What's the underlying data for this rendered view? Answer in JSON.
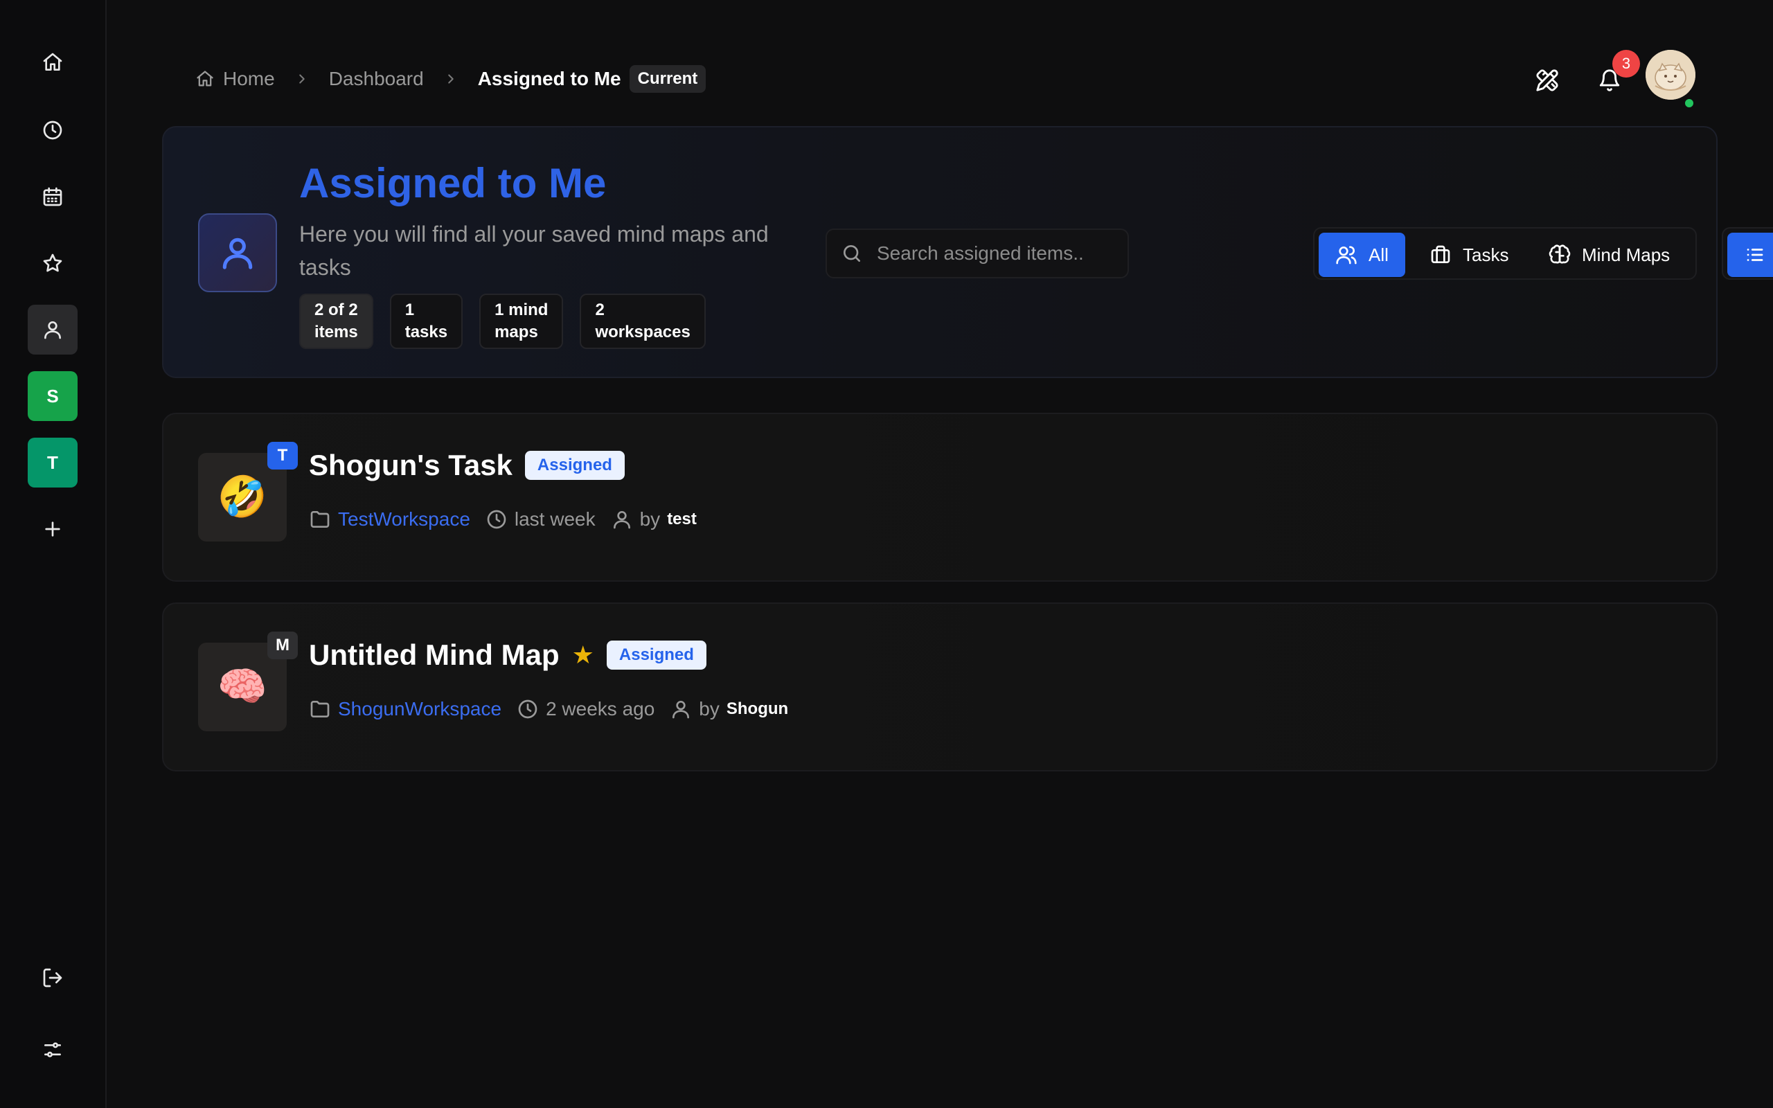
{
  "sidebar": {
    "items": [
      {
        "icon": "home-icon"
      },
      {
        "icon": "clock-icon"
      },
      {
        "icon": "calendar-icon"
      },
      {
        "icon": "star-icon"
      },
      {
        "icon": "user-icon",
        "active": true
      }
    ],
    "workspaces": [
      {
        "letter": "S",
        "color": "#16a34a"
      },
      {
        "letter": "T",
        "color": "#059669"
      }
    ]
  },
  "breadcrumb": {
    "home": "Home",
    "dashboard": "Dashboard",
    "current": "Assigned to Me",
    "current_badge": "Current"
  },
  "header": {
    "notification_count": "3"
  },
  "hero": {
    "title": "Assigned to Me",
    "subtitle": "Here you will find all your saved mind maps and tasks",
    "stats": [
      {
        "line1": "2 of 2",
        "line2": "items"
      },
      {
        "line1": "1",
        "line2": "tasks"
      },
      {
        "line1": "1 mind",
        "line2": "maps"
      },
      {
        "line1": "2",
        "line2": "workspaces"
      }
    ],
    "search_placeholder": "Search assigned items...",
    "filters": {
      "all": "All",
      "tasks": "Tasks",
      "mind_maps": "Mind Maps"
    }
  },
  "items": [
    {
      "title": "Shogun's Task",
      "type_letter": "T",
      "emoji": "🤣",
      "badge": "Assigned",
      "workspace": "TestWorkspace",
      "time": "last week",
      "by_label": "by",
      "author": "test",
      "starred": false
    },
    {
      "title": "Untitled Mind Map",
      "type_letter": "M",
      "emoji": "🧠",
      "badge": "Assigned",
      "workspace": "ShogunWorkspace",
      "time": "2 weeks ago",
      "by_label": "by",
      "author": "Shogun",
      "starred": true,
      "star": "★"
    }
  ],
  "colors": {
    "accent": "#2563eb",
    "title_blue": "#2f63e6",
    "badge_red": "#ef4444",
    "online_green": "#22c55e",
    "star_yellow": "#eab308"
  }
}
